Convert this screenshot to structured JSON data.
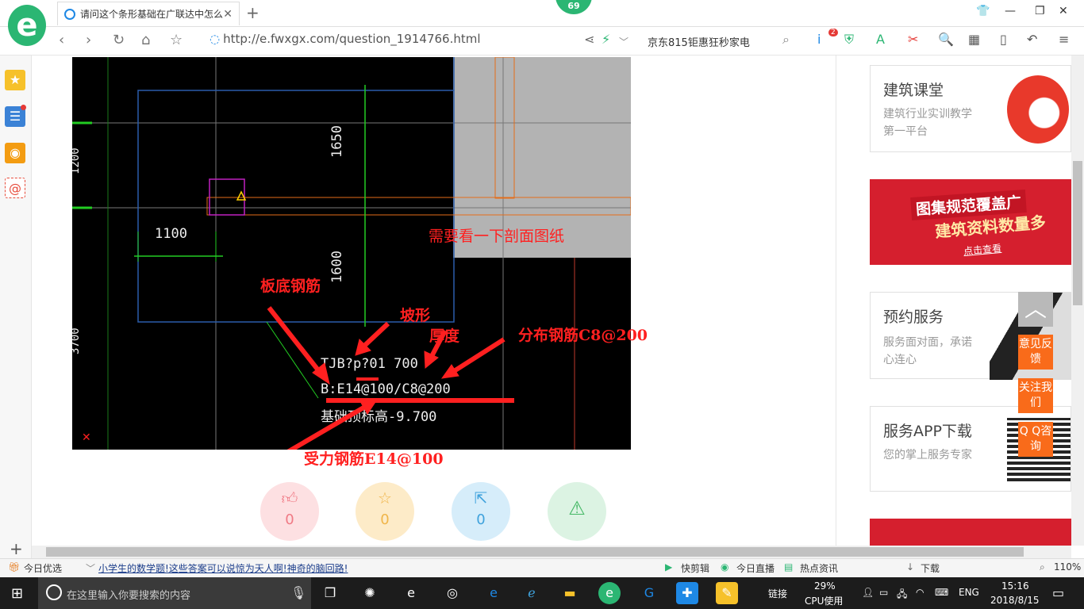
{
  "browser": {
    "tab_title": "请问这个条形基础在广联达中怎么",
    "tab_close": "✕",
    "new_tab": "+",
    "badge_count": "69",
    "url": "http://e.fwxgx.com/question_1914766.html",
    "search_text": "京东815钜惠狂秒家电",
    "ext_badge": "2"
  },
  "cad": {
    "dim_1650": "1650",
    "dim_1600": "1600",
    "dim_1100": "1100",
    "dim_1200": "1200",
    "dim_3700": "3700",
    "label_line1": "TJB?p?01  700",
    "label_line2": "B:E14@100/C8@200",
    "label_line3": "基础顶标高-9.700",
    "note_section": "需要看一下剖面图纸",
    "note_bottom_bar": "板底钢筋",
    "note_slope": "坡形",
    "note_thickness": "厚度",
    "note_dist": "分布钢筋C8@200",
    "note_main": "受力钢筋E14@100"
  },
  "actions": {
    "like_count": "0",
    "fav_count": "0",
    "share_count": "0"
  },
  "right": {
    "card1_title": "建筑课堂",
    "card1_desc": "建筑行业实训教学第一平台",
    "banner_line1": "图集规范覆盖广",
    "banner_line2": "建筑资料数量多",
    "banner_cta": "点击查看",
    "card2_title": "预约服务",
    "card2_desc": "服务面对面，承诺心连心",
    "card3_title": "服务APP下载",
    "card3_desc": "您的掌上服务专家",
    "float_feedback": "意见反馈",
    "float_follow": "关注我们",
    "float_qq": "Q Q咨询"
  },
  "statusbar": {
    "today": "今日优选",
    "headline": "小学生的数学题!这些答案可以说惊为天人啊!神奇的脑回路!",
    "clip": "快剪辑",
    "live": "今日直播",
    "news": "热点资讯",
    "download": "下载",
    "zoom": "110%"
  },
  "taskbar": {
    "search_placeholder": "在这里输入你要搜索的内容",
    "link_label": "链接",
    "cpu_pct": "29%",
    "cpu_label": "CPU使用",
    "lang": "ENG",
    "time": "15:16",
    "date": "2018/8/15"
  },
  "colors": {
    "brand": "#2bb673",
    "annotation": "#ff2020",
    "float_orange": "#f96b1a"
  }
}
